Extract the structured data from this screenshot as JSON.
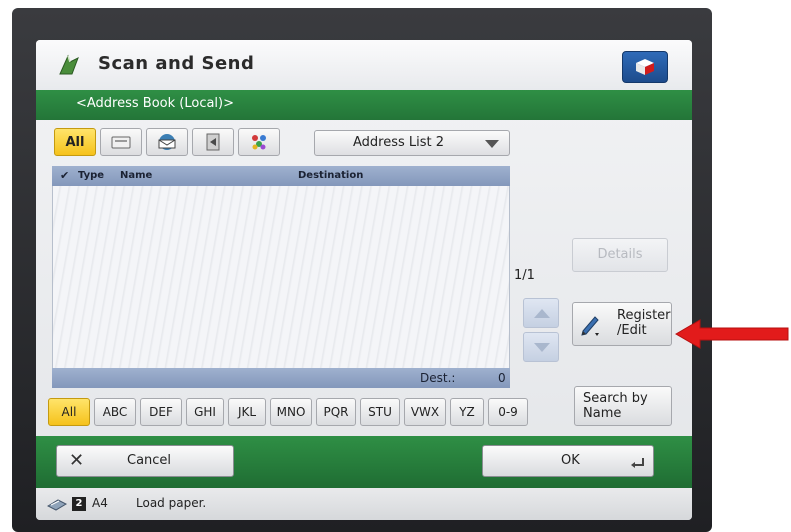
{
  "app": {
    "title": "Scan and Send",
    "breadcrumb": "<Address Book (Local)>"
  },
  "toolbar": {
    "filters": [
      {
        "label": "All",
        "icon": "all",
        "active": true
      },
      {
        "label": "",
        "icon": "fax-icon"
      },
      {
        "label": "",
        "icon": "email-icon"
      },
      {
        "label": "",
        "icon": "file-server-icon"
      },
      {
        "label": "",
        "icon": "group-icon"
      }
    ],
    "address_list": "Address List 2"
  },
  "table": {
    "columns": [
      "Type",
      "Name",
      "Destination"
    ],
    "rows": [],
    "dest_label": "Dest.:",
    "dest_count": "0"
  },
  "side": {
    "page": "1/1",
    "details_label": "Details",
    "register_label": "Register\n/Edit",
    "search_name_label": "Search by\nName"
  },
  "alpha_tabs": [
    "All",
    "ABC",
    "DEF",
    "GHI",
    "JKL",
    "MNO",
    "PQR",
    "STU",
    "VWX",
    "YZ",
    "0-9"
  ],
  "bottom": {
    "cancel_label": "Cancel",
    "ok_label": "OK"
  },
  "status": {
    "num": "2",
    "size": "A4",
    "message": "Load paper."
  },
  "colors": {
    "accent_green": "#2f8f45",
    "active_yellow": "#f5c21b",
    "header_blue": "#8397bb",
    "annotation_red": "#e21b1b"
  }
}
